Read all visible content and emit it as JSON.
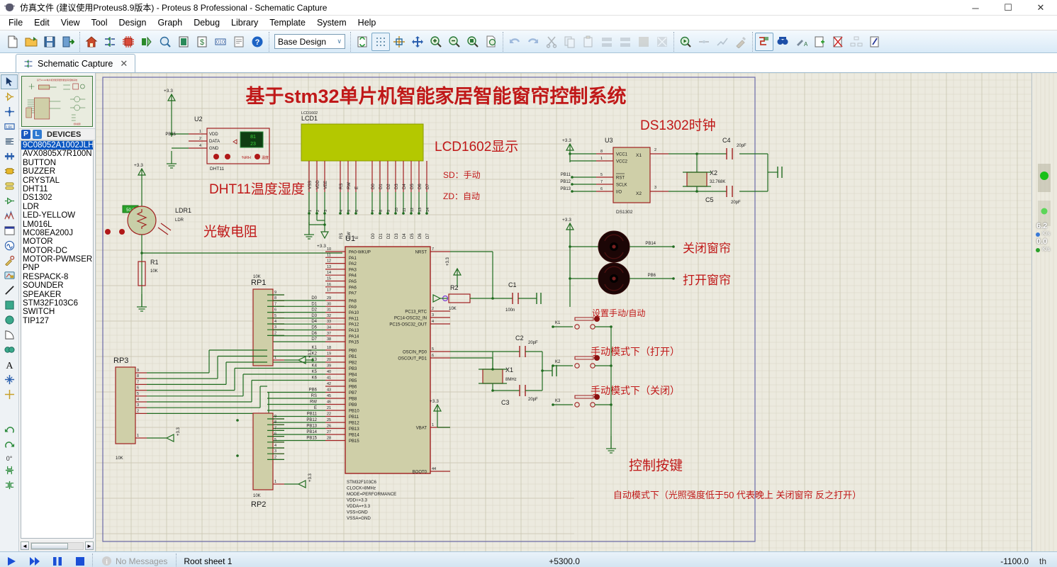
{
  "window": {
    "title": "仿真文件 (建议使用Proteus8.9版本)  - Proteus 8 Professional - Schematic Capture",
    "icon": "proteus-bug-icon",
    "minimize": "─",
    "maximize": "☐",
    "close": "✕"
  },
  "menubar": {
    "items": [
      "File",
      "Edit",
      "View",
      "Tool",
      "Design",
      "Graph",
      "Debug",
      "Library",
      "Template",
      "System",
      "Help"
    ]
  },
  "toolbar": {
    "design_combo_value": "Base Design",
    "design_combo_caret": "∨"
  },
  "tab": {
    "label": "Schematic Capture",
    "close": "✕"
  },
  "devices_panel": {
    "header": "DEVICES",
    "badge_p": "P",
    "badge_l": "L",
    "selected": "9C08052A1002JLH",
    "items": [
      "9C08052A1002JLH",
      "AVX0805X7R100N",
      "BUTTON",
      "BUZZER",
      "CRYSTAL",
      "DHT11",
      "DS1302",
      "LDR",
      "LED-YELLOW",
      "LM016L",
      "MC08EA200J",
      "MOTOR",
      "MOTOR-DC",
      "MOTOR-PWMSER",
      "PNP",
      "RESPACK-8",
      "SOUNDER",
      "SPEAKER",
      "STM32F103C6",
      "SWITCH",
      "TIP127"
    ]
  },
  "statusbar": {
    "messages": "No Messages",
    "sheet": "Root sheet 1",
    "coord_x": "+5300.0",
    "coord_y": "-1100.0",
    "units": "th"
  },
  "right_panel": {
    "rate1_value": "6.2",
    "rate1_unit": "K/s",
    "rate2_value": "0.0",
    "rate2_unit": "K/s"
  },
  "schematic": {
    "title": "基于stm32单片机智能家居智能窗帘控制系统",
    "annotations": {
      "dht11": "DHT11温度湿度",
      "ldr": "光敏电阻",
      "lcd": "LCD1602显示",
      "sd": "SD：手动",
      "zd": "ZD：自动",
      "ds1302": "DS1302时钟",
      "close_curtain": "关闭窗帘",
      "open_curtain": "打开窗帘",
      "set_mode": "设置手动/自动",
      "manual_open": "手动模式下（打开）",
      "manual_close": "手动模式下（关闭）",
      "control_keys": "控制按键",
      "auto_note": "自动模式下（光照强度低于50 代表晚上 关闭窗帘  反之打开）"
    },
    "components": {
      "u1": {
        "ref": "U1",
        "spec": [
          "STM32F103C6",
          "CLOCK=8MHz",
          "MODE=PERFORMANCE",
          "VDD=+3.3",
          "VDDA=+3.3",
          "VSS=GND",
          "VSSA=GND"
        ],
        "left_pins": [
          {
            "num": "10",
            "name": "PA0-WKUP",
            "net": ""
          },
          {
            "num": "11",
            "name": "PA1",
            "net": ""
          },
          {
            "num": "12",
            "name": "PA2",
            "net": ""
          },
          {
            "num": "13",
            "name": "PA3",
            "net": ""
          },
          {
            "num": "14",
            "name": "PA4",
            "net": ""
          },
          {
            "num": "15",
            "name": "PA5",
            "net": ""
          },
          {
            "num": "16",
            "name": "PA6",
            "net": ""
          },
          {
            "num": "17",
            "name": "PA7",
            "net": ""
          },
          {
            "num": "29",
            "name": "PA8",
            "net": "D0"
          },
          {
            "num": "30",
            "name": "PA9",
            "net": "D1"
          },
          {
            "num": "31",
            "name": "PA10",
            "net": "D2"
          },
          {
            "num": "32",
            "name": "PA11",
            "net": "D3"
          },
          {
            "num": "33",
            "name": "PA12",
            "net": "D4"
          },
          {
            "num": "34",
            "name": "PA13",
            "net": "D5"
          },
          {
            "num": "37",
            "name": "PA14",
            "net": "D6"
          },
          {
            "num": "38",
            "name": "PA15",
            "net": "D7"
          },
          {
            "num": "18",
            "name": "PB0",
            "net": "K1"
          },
          {
            "num": "19",
            "name": "PB1",
            "net": "K2"
          },
          {
            "num": "20",
            "name": "PB2",
            "net": "K3"
          },
          {
            "num": "39",
            "name": "PB3",
            "net": "K4"
          },
          {
            "num": "40",
            "name": "PB4",
            "net": "K5"
          },
          {
            "num": "41",
            "name": "PB5",
            "net": "K6"
          },
          {
            "num": "42",
            "name": "PB6",
            "net": ""
          },
          {
            "num": "43",
            "name": "PB7",
            "net": "PB6"
          },
          {
            "num": "45",
            "name": "PB8",
            "net": "RS"
          },
          {
            "num": "46",
            "name": "PB9",
            "net": "RW"
          },
          {
            "num": "21",
            "name": "PB10",
            "net": "E"
          },
          {
            "num": "22",
            "name": "PB11",
            "net": "PB11"
          },
          {
            "num": "25",
            "name": "PB12",
            "net": "PB12"
          },
          {
            "num": "26",
            "name": "PB13",
            "net": "PB13"
          },
          {
            "num": "27",
            "name": "PB14",
            "net": "PB14"
          },
          {
            "num": "28",
            "name": "PB15",
            "net": "PB15"
          }
        ],
        "right_pins": [
          {
            "num": "7",
            "name": "NRST"
          },
          {
            "num": "2",
            "name": "PC13_RTC"
          },
          {
            "num": "3",
            "name": "PC14-OSC32_IN"
          },
          {
            "num": "4",
            "name": "PC15-OSC32_OUT"
          },
          {
            "num": "5",
            "name": "OSCIN_PD0"
          },
          {
            "num": "6",
            "name": "OSCOUT_PD1"
          },
          {
            "num": "1",
            "name": "VBAT"
          },
          {
            "num": "44",
            "name": "BOOT0"
          }
        ]
      },
      "u2": {
        "ref": "U2",
        "type": "DHT11",
        "pins": [
          {
            "num": "1",
            "name": "VDD"
          },
          {
            "num": "2",
            "name": "DATA"
          },
          {
            "num": "4",
            "name": "GND"
          }
        ],
        "net": "PB15",
        "display_top": "81",
        "display_bottom": "23",
        "display_label": "%RH",
        "display_label2": "温度"
      },
      "u3": {
        "ref": "U3",
        "type": "DS1302",
        "left_pins": [
          {
            "num": "8",
            "name": "VCC1",
            "net": ""
          },
          {
            "num": "1",
            "name": "VCC2",
            "net": ""
          },
          {
            "num": "5",
            "name": "RST",
            "net": "PB11"
          },
          {
            "num": "7",
            "name": "SCLK",
            "net": "PB12"
          },
          {
            "num": "6",
            "name": "I/O",
            "net": "PB13"
          }
        ],
        "right_pins": [
          {
            "num": "2",
            "name": "X1"
          },
          {
            "num": "3",
            "name": "X2"
          }
        ]
      },
      "lcd1": {
        "ref": "LCD1",
        "type": "LCD1602",
        "pin_names": [
          "VSS",
          "VDD",
          "VEE",
          "RS",
          "RW",
          "E",
          "D0",
          "D1",
          "D2",
          "D3",
          "D4",
          "D5",
          "D6",
          "D7"
        ],
        "pin_nums": [
          "1",
          "2",
          "3",
          "4",
          "5",
          "6",
          "7",
          "8",
          "9",
          "10",
          "11",
          "12",
          "13",
          "14"
        ],
        "nets": [
          "",
          "",
          "",
          "RS",
          "RW",
          "E",
          "D0",
          "D1",
          "D2",
          "D3",
          "D4",
          "D5",
          "D6",
          "D7"
        ]
      },
      "ldr1": {
        "ref": "LDR1",
        "type": "LDR",
        "reading": "50.0"
      },
      "r1": {
        "ref": "R1",
        "value": "10K"
      },
      "r2": {
        "ref": "R2",
        "value": "10K"
      },
      "c1": {
        "ref": "C1",
        "value": "100n"
      },
      "c2": {
        "ref": "C2",
        "value": "20pF"
      },
      "c3": {
        "ref": "C3",
        "value": "20pF"
      },
      "c4": {
        "ref": "C4",
        "value": "20pF"
      },
      "c5": {
        "ref": "C5",
        "value": "20pF"
      },
      "x1": {
        "ref": "X1",
        "value": "8MHz"
      },
      "x2": {
        "ref": "X2",
        "value": "32.768K"
      },
      "rp1": {
        "ref": "RP1",
        "value": "10K",
        "pins": [
          "9",
          "8",
          "7",
          "6",
          "5",
          "4",
          "3",
          "2",
          "1"
        ]
      },
      "rp2": {
        "ref": "RP2",
        "value": "10K",
        "pins": [
          "9",
          "8",
          "7",
          "6",
          "5",
          "4",
          "3",
          "2",
          "1"
        ]
      },
      "rp3": {
        "ref": "RP3",
        "value": "10K",
        "pins": [
          "9",
          "8",
          "7",
          "6",
          "5",
          "4",
          "3",
          "2",
          "1"
        ]
      },
      "motors": [
        {
          "net": "PB14"
        },
        {
          "net": "PB6"
        }
      ],
      "keys": [
        {
          "ref": "K1"
        },
        {
          "ref": "K2"
        },
        {
          "ref": "K3"
        }
      ]
    },
    "power_labels": [
      "+3.3",
      "+3.3",
      "+3.3",
      "+3.3",
      "+3.3",
      "+3.3",
      "+3.3",
      "+3.3",
      "+3.3"
    ],
    "colors": {
      "sheet_bg": "#eceadf",
      "grid": "#d8d5c4",
      "wire": "#1f6b1f",
      "body": "#cfcfa8",
      "outline": "#a02020",
      "title_red": "#c01818",
      "lcd_screen": "#b4c800"
    }
  }
}
